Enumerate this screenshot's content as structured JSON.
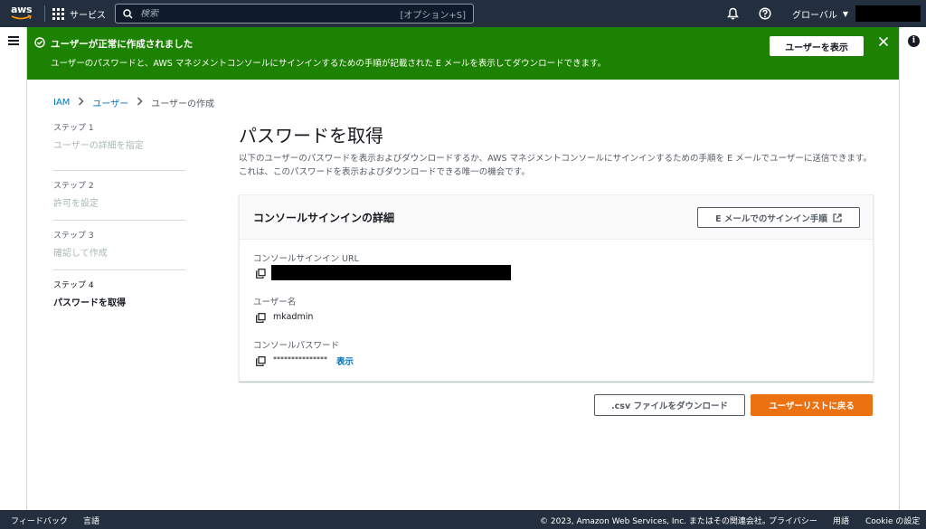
{
  "topnav": {
    "logo_text": "aws",
    "services_label": "サービス",
    "search_placeholder": "検索",
    "search_shortcut": "[オプション+S]",
    "region_label": "グローバル"
  },
  "flash": {
    "title": "ユーザーが正常に作成されました",
    "message": "ユーザーのパスワードと、AWS マネジメントコンソールにサインインするための手順が記載された E メールを表示してダウンロードできます。",
    "view_user_button": "ユーザーを表示"
  },
  "breadcrumb": {
    "items": [
      "IAM",
      "ユーザー"
    ],
    "current": "ユーザーの作成"
  },
  "steps": [
    {
      "num": "ステップ 1",
      "label": "ユーザーの詳細を指定"
    },
    {
      "num": "ステップ 2",
      "label": "許可を設定"
    },
    {
      "num": "ステップ 3",
      "label": "確認して作成"
    },
    {
      "num": "ステップ 4",
      "label": "パスワードを取得"
    }
  ],
  "main": {
    "title": "パスワードを取得",
    "description": "以下のユーザーのパスワードを表示およびダウンロードするか、AWS マネジメントコンソールにサインインするための手順を E メールでユーザーに送信できます。これは、このパスワードを表示およびダウンロードできる唯一の機会です。"
  },
  "panel": {
    "title": "コンソールサインインの詳細",
    "email_button": "E メールでのサインイン手順",
    "url_label": "コンソールサインイン URL",
    "username_label": "ユーザー名",
    "username_value": "mkadmin",
    "password_label": "コンソールパスワード",
    "password_value": "***************",
    "show_link": "表示"
  },
  "actions": {
    "download_csv": ".csv ファイルをダウンロード",
    "back_to_list": "ユーザーリストに戻る"
  },
  "footer": {
    "feedback": "フィードバック",
    "language": "言語",
    "copyright": "© 2023, Amazon Web Services, Inc. またはその関連会社。",
    "privacy": "プライバシー",
    "terms": "用語",
    "cookie": "Cookie の設定"
  },
  "colors": {
    "nav_bg": "#232f3e",
    "success_green": "#1d8102",
    "link_blue": "#0073bb",
    "primary_orange": "#ec7211"
  }
}
